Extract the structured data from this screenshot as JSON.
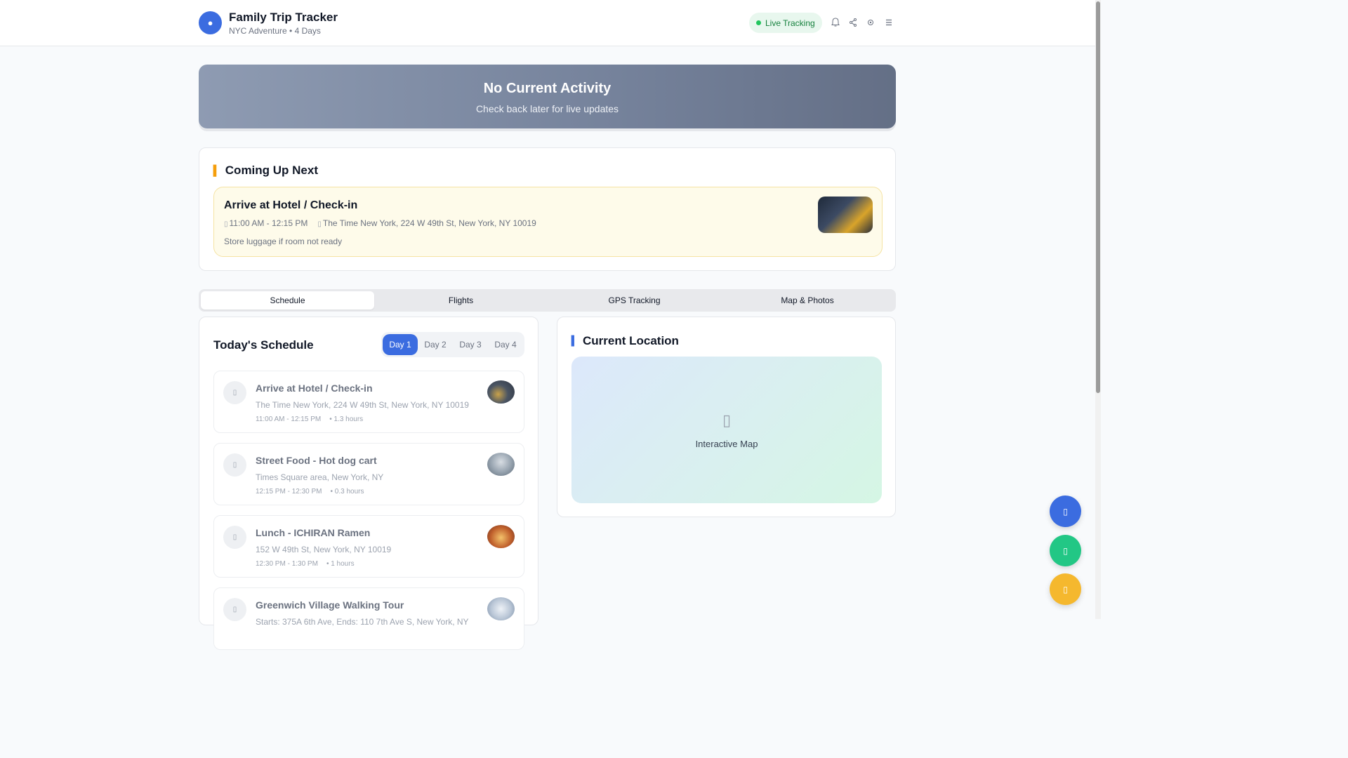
{
  "header": {
    "title": "Family Trip Tracker",
    "subtitle": "NYC Adventure • 4 Days",
    "live_badge": "Live Tracking",
    "icons": [
      "bell-icon",
      "share-icon",
      "settings-icon",
      "menu-icon"
    ]
  },
  "banner": {
    "title": "No Current Activity",
    "subtitle": "Check back later for live updates"
  },
  "coming_up": {
    "heading": "Coming Up Next",
    "title": "Arrive at Hotel / Check-in",
    "time": "11:00 AM - 12:15 PM",
    "location": "The Time New York, 224 W 49th St, New York, NY 10019",
    "note": "Store luggage if room not ready"
  },
  "tabs": [
    "Schedule",
    "Flights",
    "GPS Tracking",
    "Map & Photos"
  ],
  "schedule": {
    "title": "Today's Schedule",
    "days": [
      "Day 1",
      "Day 2",
      "Day 3",
      "Day 4"
    ],
    "activities": [
      {
        "title": "Arrive at Hotel / Check-in",
        "location": "The Time New York, 224 W 49th St, New York, NY 10019",
        "time": "11:00 AM - 12:15 PM",
        "duration": "• 1.3 hours"
      },
      {
        "title": "Street Food - Hot dog cart",
        "location": "Times Square area, New York, NY",
        "time": "12:15 PM - 12:30 PM",
        "duration": "• 0.3 hours"
      },
      {
        "title": "Lunch - ICHIRAN Ramen",
        "location": "152 W 49th St, New York, NY 10019",
        "time": "12:30 PM - 1:30 PM",
        "duration": "• 1 hours"
      },
      {
        "title": "Greenwich Village Walking Tour",
        "location": "Starts: 375A 6th Ave, Ends: 110 7th Ave S, New York, NY",
        "time": "",
        "duration": ""
      }
    ]
  },
  "location": {
    "heading": "Current Location",
    "map_label": "Interactive Map"
  },
  "colors": {
    "primary": "#3b6ce0",
    "success": "#22c55e",
    "warning": "#f5b82e",
    "fab_green": "#22c785"
  }
}
